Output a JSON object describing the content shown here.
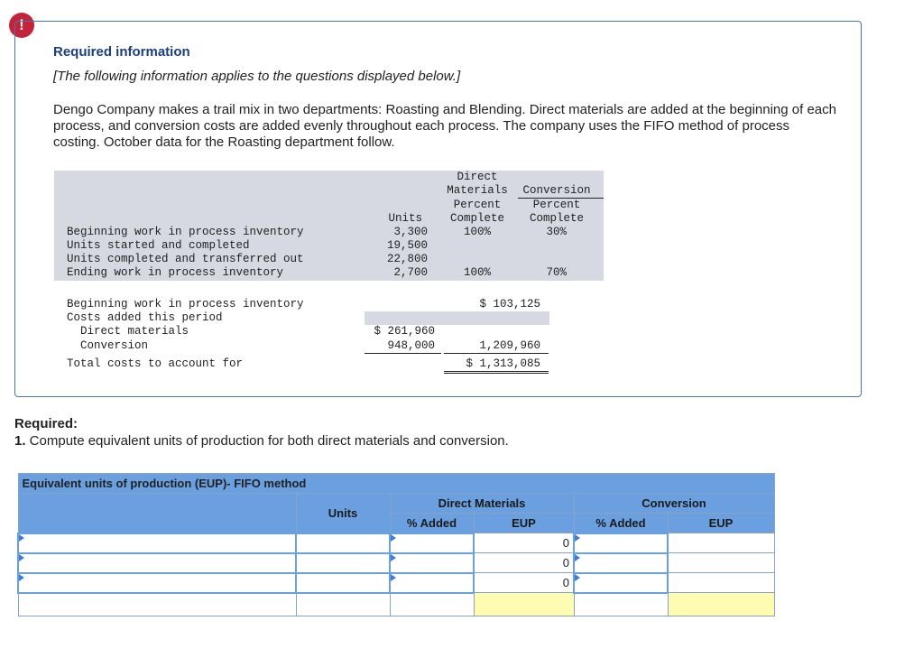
{
  "alert_symbol": "!",
  "info": {
    "title": "Required information",
    "note": "[The following information applies to the questions displayed below.]",
    "paragraph": "Dengo Company makes a trail mix in two departments: Roasting and Blending. Direct materials are added at the beginning of each process, and conversion costs are added evenly throughout each process. The company uses the FIFO method of process costing. October data for the Roasting department follow."
  },
  "data_table": {
    "col_headers": {
      "dm_line1": "Direct",
      "dm_line2": "Materials",
      "dm_line3": "Percent",
      "dm_line4": "Complete",
      "conv_line1": "Conversion",
      "conv_line2": "Percent",
      "conv_line3": "Complete",
      "units": "Units"
    },
    "rows": [
      {
        "label": "Beginning work in process inventory",
        "units": "3,300",
        "dm": "100%",
        "conv": "30%"
      },
      {
        "label": "Units started and completed",
        "units": "19,500",
        "dm": "",
        "conv": ""
      },
      {
        "label": "Units completed and transferred out",
        "units": "22,800",
        "dm": "",
        "conv": ""
      },
      {
        "label": "Ending work in process inventory",
        "units": "2,700",
        "dm": "100%",
        "conv": "70%"
      }
    ]
  },
  "cost_table": {
    "beginning_label": "Beginning work in process inventory",
    "beginning_value": "$ 103,125",
    "added_label": "Costs added this period",
    "dm_label": "Direct materials",
    "dm_value": "$ 261,960",
    "conv_label": "Conversion",
    "conv_value": "948,000",
    "subtotal": "1,209,960",
    "total_label": "Total costs to account for",
    "total_value": "$ 1,313,085"
  },
  "required": {
    "label": "Required:",
    "number": "1.",
    "text": " Compute equivalent units of production for both direct materials and conversion."
  },
  "eup_table": {
    "title": "Equivalent units of production (EUP)- FIFO method",
    "units_header": "Units",
    "dm_header": "Direct Materials",
    "conv_header": "Conversion",
    "pct_added": "% Added",
    "eup": "EUP",
    "rows": [
      {
        "dm_eup": "0"
      },
      {
        "dm_eup": "0"
      },
      {
        "dm_eup": "0"
      }
    ]
  },
  "colors": {
    "header_blue": "#6a9fe0",
    "total_yellow": "#fdfcb0",
    "alert_red": "#c4233c",
    "title_blue": "#1b3f7a"
  }
}
